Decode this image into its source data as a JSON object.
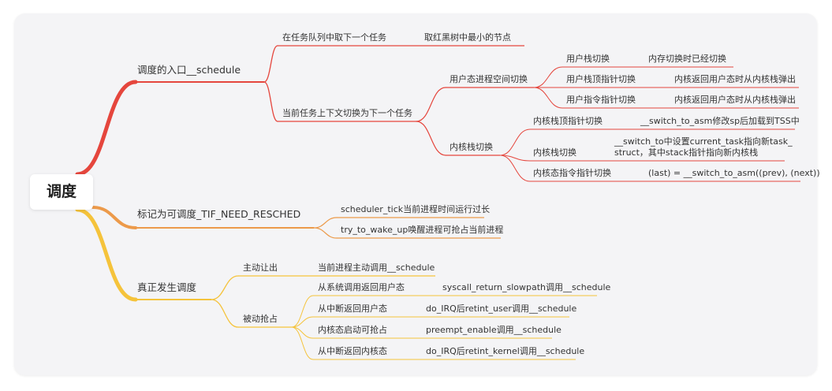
{
  "root": "调度",
  "colors": {
    "red": "#e5463d",
    "orange": "#ec9a4a",
    "yellow": "#f5c33b"
  },
  "b1": {
    "label": "调度的入口__schedule"
  },
  "b1a": {
    "label": "在任务队列中取下一个任务",
    "child": "取红黑树中最小的节点"
  },
  "b1b": {
    "label": "当前任务上下文切换为下一个任务"
  },
  "user": {
    "label": "用户态进程空间切换",
    "items": [
      {
        "label": "用户栈切换",
        "detail": "内存切换时已经切换"
      },
      {
        "label": "用户栈顶指针切换",
        "detail": "内核返回用户态时从内核栈弹出"
      },
      {
        "label": "用户指令指针切换",
        "detail": "内核返回用户态时从内核栈弹出"
      }
    ]
  },
  "kernel": {
    "label": "内核栈切换",
    "items": [
      {
        "label": "内核栈顶指针切换",
        "detail": "__switch_to_asm修改sp后加载到TSS中"
      },
      {
        "label": "内核栈切换",
        "detail_line1": "__switch_to中设置current_task指向新task_",
        "detail_line2": "struct，其中stack指针指向新内核栈"
      },
      {
        "label": "内核态指令指针切换",
        "detail": "(last) = __switch_to_asm((prev), (next))"
      }
    ]
  },
  "b2": {
    "label": "标记为可调度_TIF_NEED_RESCHED",
    "items": [
      "scheduler_tick当前进程时间运行过长",
      "try_to_wake_up唤醒进程可抢占当前进程"
    ]
  },
  "b3": {
    "label": "真正发生调度",
    "voluntary": {
      "label": "主动让出",
      "detail": "当前进程主动调用__schedule"
    },
    "preempt": {
      "label": "被动抢占",
      "items": [
        {
          "label": "从系统调用返回用户态",
          "detail": "syscall_return_slowpath调用__schedule"
        },
        {
          "label": "从中断返回用户态",
          "detail": "do_IRQ后retint_user调用__schedule"
        },
        {
          "label": "内核态启动可抢占",
          "detail": "preempt_enable调用__schedule"
        },
        {
          "label": "从中断返回内核态",
          "detail": "do_IRQ后retint_kernel调用__schedule"
        }
      ]
    }
  }
}
